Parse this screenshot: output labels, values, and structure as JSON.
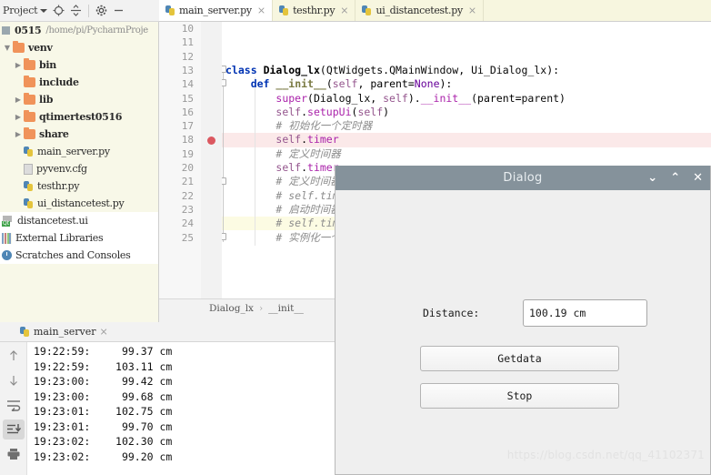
{
  "ide": {
    "toolbar": {
      "project_label": "Project",
      "icons": [
        "locate-target-icon",
        "collapse-all-icon",
        "settings-gear-icon",
        "minimize-icon"
      ]
    },
    "tabs": [
      {
        "label": "main_server.py",
        "active": true,
        "close": "×"
      },
      {
        "label": "testhr.py",
        "active": false,
        "close": "×"
      },
      {
        "label": "ui_distancetest.py",
        "active": false,
        "close": "×"
      }
    ],
    "breadcrumb": {
      "class": "Dialog_lx",
      "separator": "›",
      "method": "__init__"
    }
  },
  "tree": {
    "project_name": "0515",
    "project_path": "/home/pi/PycharmProje",
    "items": [
      {
        "label": "venv",
        "type": "folder",
        "indent": 0,
        "arrow": "▼"
      },
      {
        "label": "bin",
        "type": "folder",
        "indent": 1,
        "arrow": "▶"
      },
      {
        "label": "include",
        "type": "folder",
        "indent": 1,
        "arrow": ""
      },
      {
        "label": "lib",
        "type": "folder",
        "indent": 1,
        "arrow": "▶"
      },
      {
        "label": "qtimertest0516",
        "type": "folder",
        "indent": 1,
        "arrow": "▶"
      },
      {
        "label": "share",
        "type": "folder",
        "indent": 1,
        "arrow": "▶"
      },
      {
        "label": "main_server.py",
        "type": "python",
        "indent": 1,
        "arrow": ""
      },
      {
        "label": "pyvenv.cfg",
        "type": "config",
        "indent": 1,
        "arrow": ""
      },
      {
        "label": "testhr.py",
        "type": "python",
        "indent": 1,
        "arrow": ""
      },
      {
        "label": "ui_distancetest.py",
        "type": "python",
        "indent": 1,
        "arrow": ""
      },
      {
        "label": "distancetest.ui",
        "type": "qt",
        "indent": 0,
        "arrow": ""
      },
      {
        "label": "External Libraries",
        "type": "lib",
        "indent": 0,
        "arrow": ""
      },
      {
        "label": "Scratches and Consoles",
        "type": "clock",
        "indent": 0,
        "arrow": ""
      }
    ]
  },
  "editor": {
    "first_line_number": 10,
    "line_numbers": [
      10,
      11,
      12,
      13,
      14,
      15,
      16,
      17,
      18,
      19,
      20,
      21,
      22,
      23,
      24,
      25
    ],
    "breakpoint_line": 18,
    "caret_line": 24,
    "lines": [
      {
        "n": 10,
        "text": ""
      },
      {
        "n": 11,
        "text": ""
      },
      {
        "n": 12,
        "text": ""
      },
      {
        "n": 13,
        "text": "class Dialog_lx(QtWidgets.QMainWindow, Ui_Dialog_lx):"
      },
      {
        "n": 14,
        "text": "    def __init__(self, parent=None):"
      },
      {
        "n": 15,
        "text": "        super(Dialog_lx, self).__init__(parent=parent)"
      },
      {
        "n": 16,
        "text": "        self.setupUi(self)"
      },
      {
        "n": 17,
        "text": "        # 初始化一个定时器"
      },
      {
        "n": 18,
        "text": "        self.timer"
      },
      {
        "n": 19,
        "text": "        # 定义时间器"
      },
      {
        "n": 20,
        "text": "        self.timer"
      },
      {
        "n": 21,
        "text": "        # 定义时间器"
      },
      {
        "n": 22,
        "text": "        # self.tim"
      },
      {
        "n": 23,
        "text": "        # 启动时间器"
      },
      {
        "n": 24,
        "text": "        # self.tim"
      },
      {
        "n": 25,
        "text": "        # 实例化一个"
      }
    ]
  },
  "console": {
    "tab_label": "main_server",
    "tab_close": "×",
    "tools": [
      {
        "name": "scroll-up-icon",
        "glyph": "↑",
        "active": false
      },
      {
        "name": "scroll-down-icon",
        "glyph": "↓",
        "active": false
      },
      {
        "name": "soft-wrap-icon",
        "glyph": "↵",
        "active": false
      },
      {
        "name": "scroll-to-end-icon",
        "glyph": "↧",
        "active": true
      },
      {
        "name": "print-icon",
        "glyph": "⎙",
        "active": false
      }
    ],
    "rows": [
      {
        "time": "19:22:59:",
        "value": "99.37 cm"
      },
      {
        "time": "19:22:59:",
        "value": "103.11 cm"
      },
      {
        "time": "19:23:00:",
        "value": "99.42 cm"
      },
      {
        "time": "19:23:00:",
        "value": "99.68 cm"
      },
      {
        "time": "19:23:01:",
        "value": "102.75 cm"
      },
      {
        "time": "19:23:01:",
        "value": "99.70 cm"
      },
      {
        "time": "19:23:02:",
        "value": "102.30 cm"
      },
      {
        "time": "19:23:02:",
        "value": "99.20 cm"
      }
    ]
  },
  "dialog": {
    "title": "Dialog",
    "titlebar_color": "#85929b",
    "window_buttons": [
      {
        "name": "minimize-button",
        "glyph": "⌄"
      },
      {
        "name": "maximize-button",
        "glyph": "⌃"
      },
      {
        "name": "close-button",
        "glyph": "✕"
      }
    ],
    "distance_label": "Distance:",
    "distance_value": "100.19 cm",
    "getdata_button": "Getdata",
    "stop_button": "Stop",
    "watermark": "https://blog.csdn.net/qq_41102371"
  }
}
